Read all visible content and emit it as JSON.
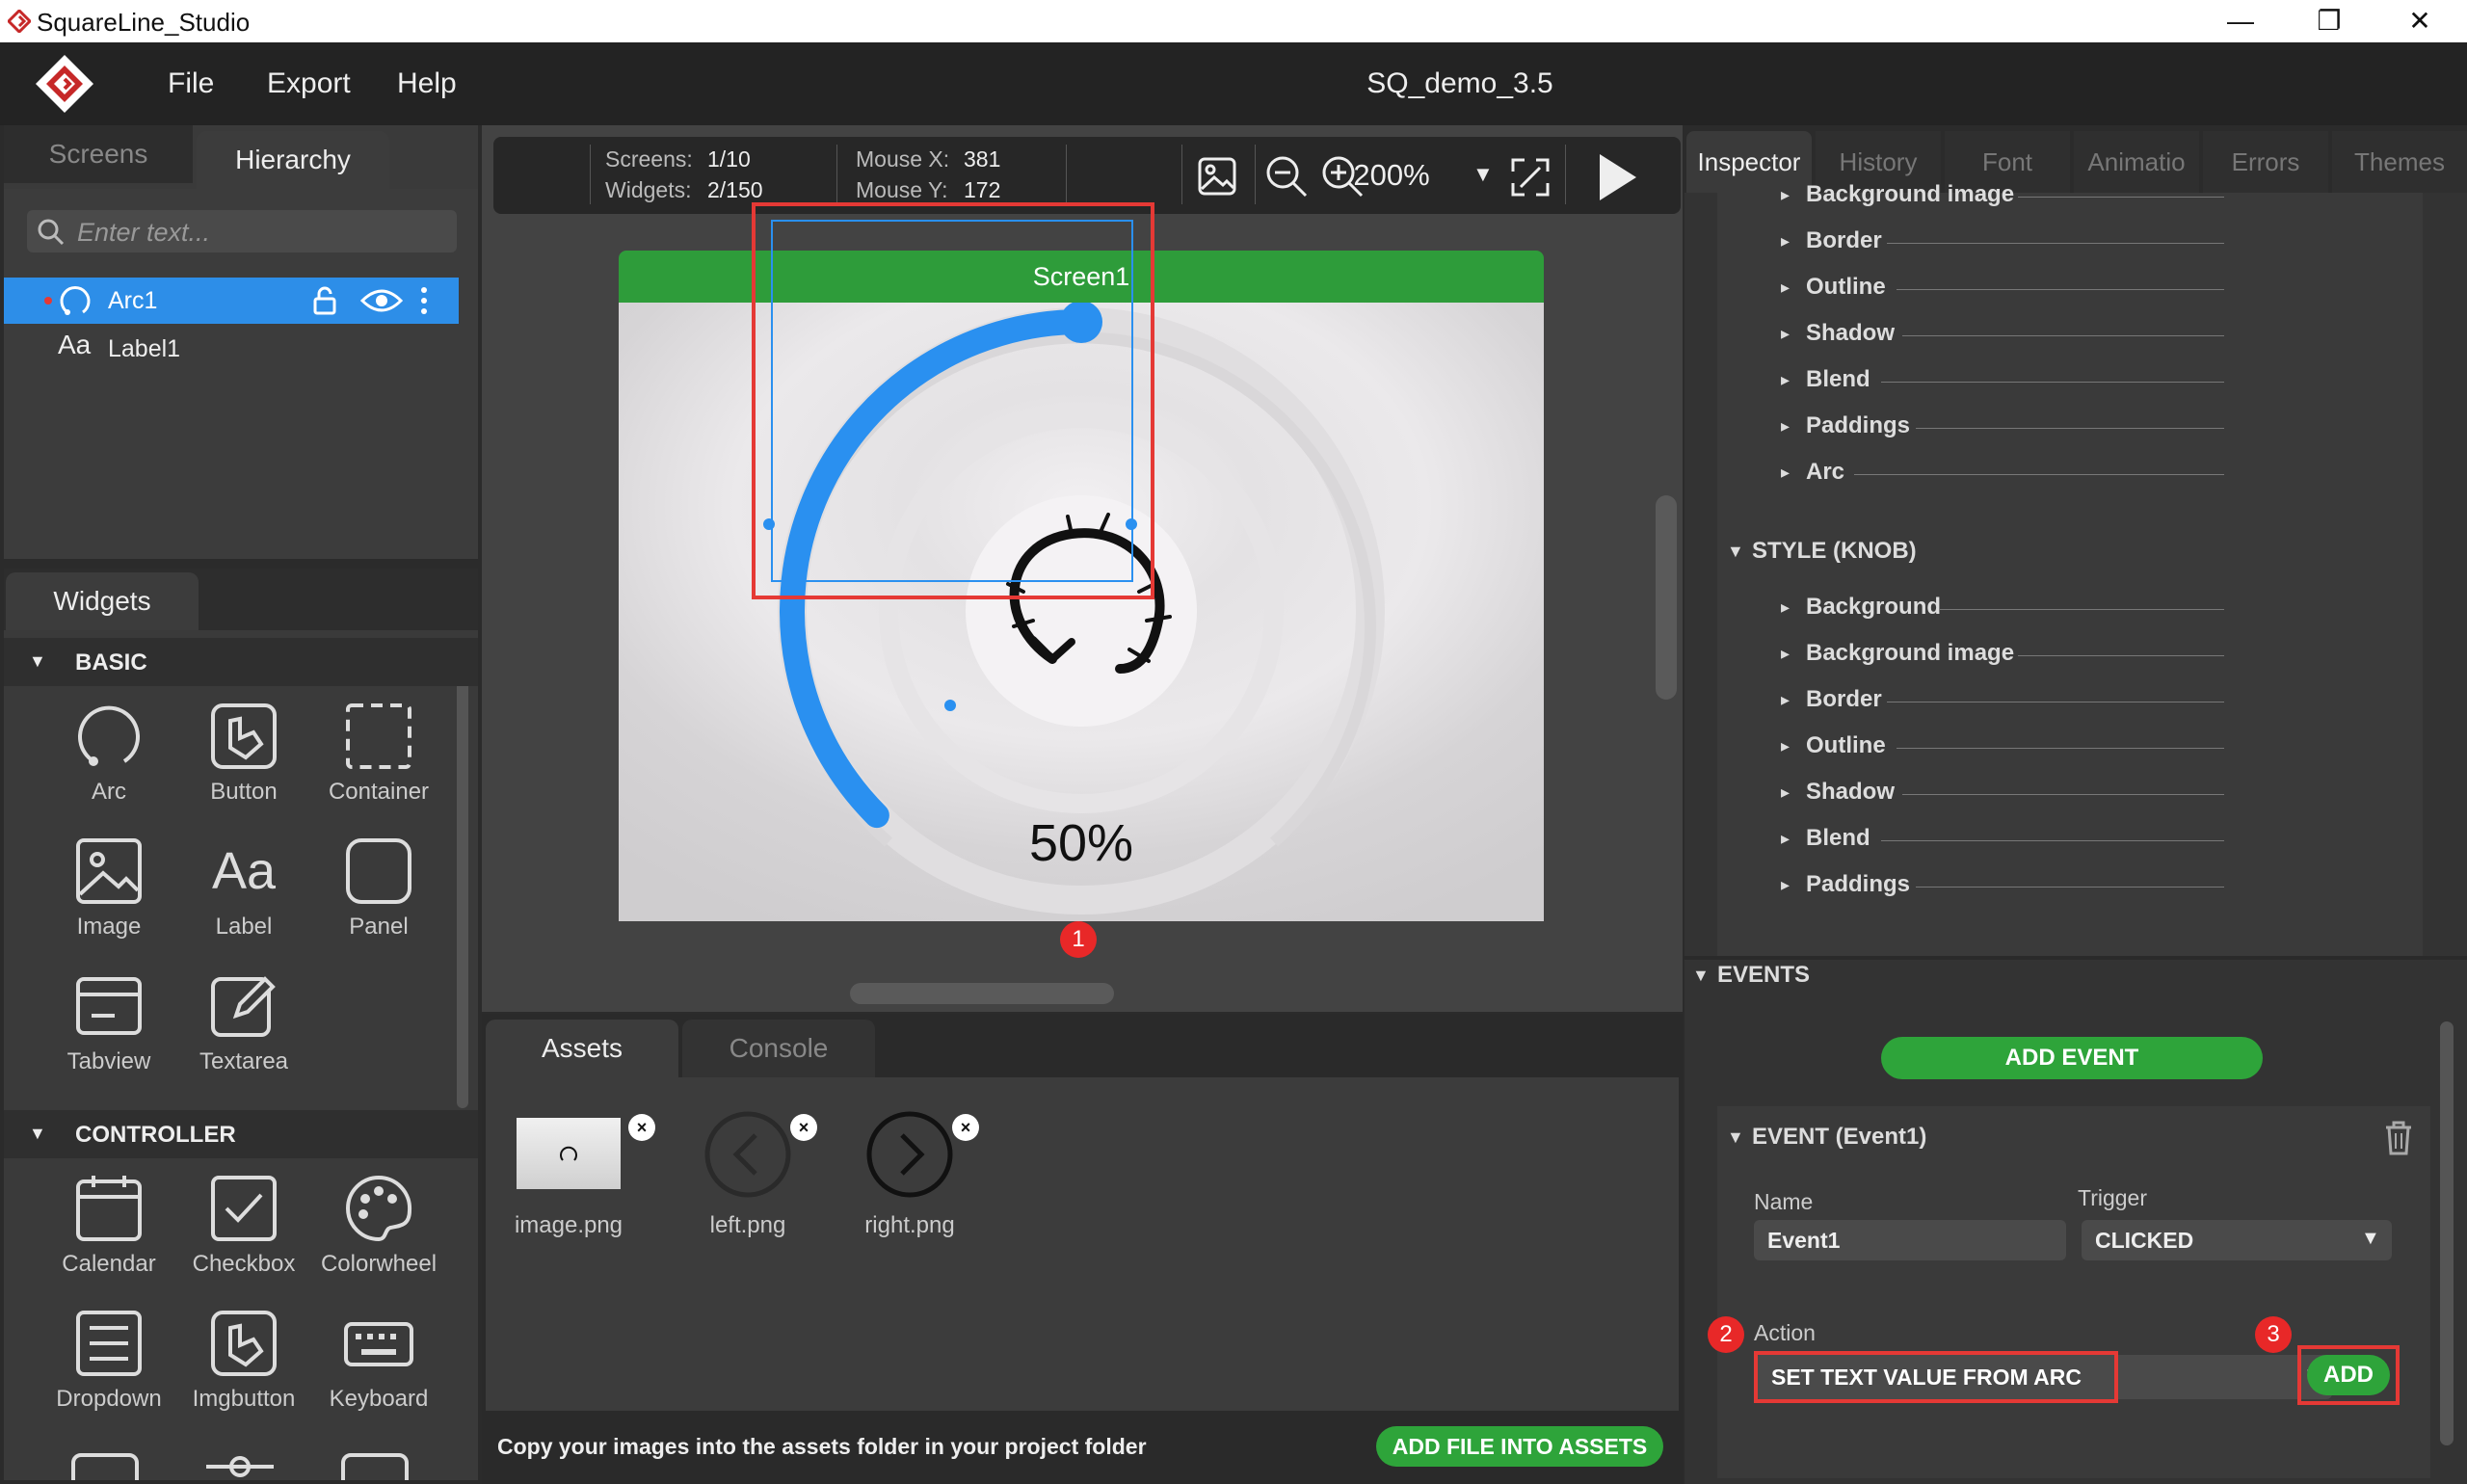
{
  "window": {
    "title": "SquareLine_Studio",
    "minimize": "—",
    "restore": "❐",
    "close": "✕"
  },
  "menu": {
    "items": [
      "File",
      "Export",
      "Help"
    ],
    "project_title": "SQ_demo_3.5"
  },
  "left_panel": {
    "tabs": [
      "Screens",
      "Hierarchy"
    ],
    "active_tab": "Hierarchy",
    "search_placeholder": "Enter text...",
    "hierarchy": [
      {
        "label": "Arc1",
        "selected": true
      },
      {
        "label": "Label1",
        "selected": false
      }
    ]
  },
  "widgets_panel": {
    "tab": "Widgets",
    "sections": [
      {
        "title": "BASIC",
        "items": [
          "Arc",
          "Button",
          "Container",
          "Image",
          "Label",
          "Panel",
          "Tabview",
          "Textarea"
        ]
      },
      {
        "title": "CONTROLLER",
        "items": [
          "Calendar",
          "Checkbox",
          "Colorwheel",
          "Dropdown",
          "Imgbutton",
          "Keyboard"
        ]
      }
    ]
  },
  "canvas": {
    "screens_label": "Screens:",
    "screens_value": "1/10",
    "widgets_label": "Widgets:",
    "widgets_value": "2/150",
    "mouse_x_label": "Mouse X:",
    "mouse_x_value": "381",
    "mouse_y_label": "Mouse Y:",
    "mouse_y_value": "172",
    "zoom": "200%",
    "screen_name": "Screen1",
    "arc_percent": "50%",
    "arc_value": 50
  },
  "assets": {
    "tabs": [
      "Assets",
      "Console"
    ],
    "active_tab": "Assets",
    "files": [
      "image.png",
      "left.png",
      "right.png"
    ],
    "hint": "Copy your images into the assets folder in your project folder",
    "add_button": "ADD FILE INTO ASSETS"
  },
  "inspector": {
    "tabs": [
      "Inspector",
      "History",
      "Font",
      "Animatio",
      "Errors",
      "Themes"
    ],
    "active_tab": "Inspector",
    "main_rows": [
      "Background image",
      "Border",
      "Outline",
      "Shadow",
      "Blend",
      "Paddings",
      "Arc"
    ],
    "knob_title": "STYLE (KNOB)",
    "knob_rows": [
      "Background",
      "Background image",
      "Border",
      "Outline",
      "Shadow",
      "Blend",
      "Paddings"
    ],
    "events_title": "EVENTS",
    "add_event_button": "ADD EVENT",
    "event_title": "EVENT (Event1)",
    "name_label": "Name",
    "name_value": "Event1",
    "trigger_label": "Trigger",
    "trigger_value": "CLICKED",
    "action_label": "Action",
    "action_value": "SET TEXT VALUE FROM ARC",
    "add_button": "ADD"
  },
  "badges": [
    "1",
    "2",
    "3"
  ],
  "colors": {
    "accent_blue": "#2d8ee8",
    "green": "#2ea43a",
    "highlight_red": "#e53935"
  }
}
